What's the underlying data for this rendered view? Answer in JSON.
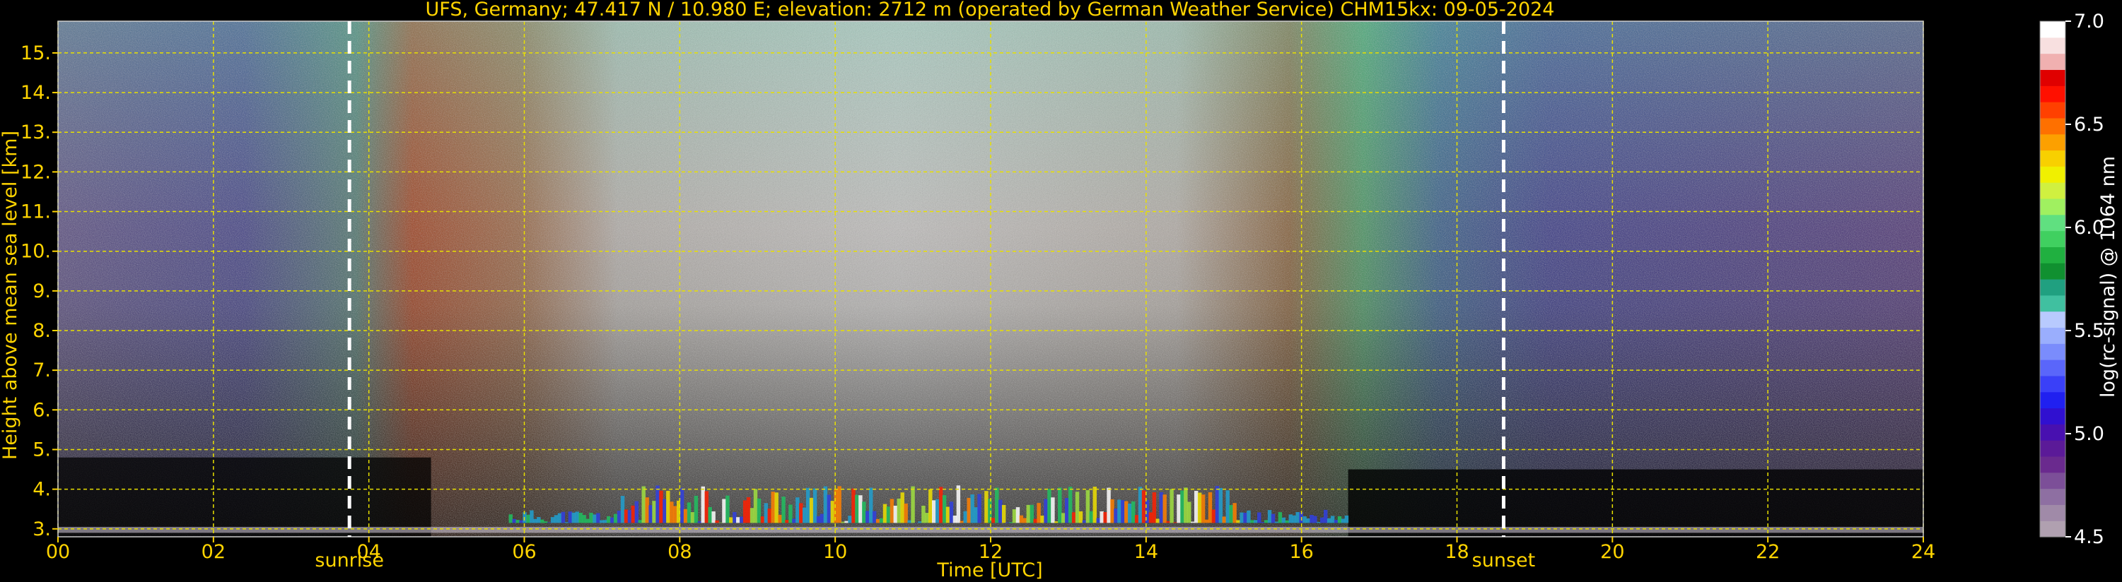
{
  "chart_data": {
    "type": "heatmap",
    "title": "UFS, Germany; 47.417 N / 10.980 E; elevation: 2712 m  (operated by German Weather Service)    CHM15kx: 09-05-2024",
    "xlabel": "Time [UTC]",
    "ylabel": "Height above mean sea level [km]",
    "xlim": [
      0,
      24
    ],
    "ylim": [
      2.8,
      15.8
    ],
    "x_ticks": [
      "00",
      "02",
      "04",
      "06",
      "08",
      "10",
      "12",
      "14",
      "16",
      "18",
      "20",
      "22",
      "24"
    ],
    "y_ticks": [
      "3.",
      "4.",
      "5.",
      "6.",
      "7.",
      "8.",
      "9.",
      "10.",
      "11.",
      "12.",
      "13.",
      "14.",
      "15."
    ],
    "grid": true,
    "annotations": [
      {
        "label": "sunrise",
        "x": 3.75
      },
      {
        "label": "sunset",
        "x": 18.6
      }
    ],
    "colorbar": {
      "label": "log(rc-signal) @ 1064 nm",
      "range": [
        4.5,
        7.0
      ],
      "ticks": [
        "4.5",
        "5.0",
        "5.5",
        "6.0",
        "6.5",
        "7.0"
      ],
      "colors": [
        "#b0a0b0",
        "#a08aa8",
        "#8e6fa2",
        "#7c4f98",
        "#6a2a8e",
        "#5b1a98",
        "#4810b0",
        "#3010d0",
        "#2020f0",
        "#3a40f8",
        "#5a66fa",
        "#7a8cfc",
        "#9aaefd",
        "#b8cafe",
        "#40c0a0",
        "#20a080",
        "#109030",
        "#20b040",
        "#40d060",
        "#60e080",
        "#a0f060",
        "#d0f040",
        "#f0f000",
        "#f8d000",
        "#fca000",
        "#fe7000",
        "#ff4000",
        "#ff1000",
        "#e00000",
        "#f0b0b0",
        "#f8e0e0",
        "#ffffff"
      ]
    },
    "cloud_layer_km": [
      3.15,
      4.1
    ]
  }
}
